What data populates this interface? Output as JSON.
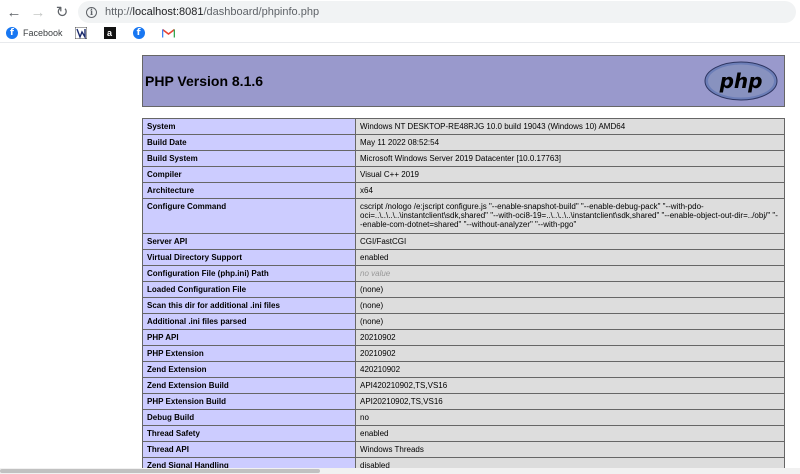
{
  "browser": {
    "url_prefix": "http://",
    "url_host": "localhost:8081",
    "url_path": "/dashboard/phpinfo.php",
    "bookmarks": [
      {
        "icon": "facebook-icon",
        "label": "Facebook"
      },
      {
        "icon": "wsj-icon",
        "label": ""
      },
      {
        "icon": "amazon-icon",
        "label": ""
      },
      {
        "icon": "facebook-icon",
        "label": ""
      },
      {
        "icon": "gmail-icon",
        "label": ""
      }
    ]
  },
  "phpinfo": {
    "title": "PHP Version 8.1.6",
    "logo_text": "php",
    "rows": [
      {
        "key": "System",
        "value": "Windows NT DESKTOP-RE48RJG 10.0 build 19043 (Windows 10) AMD64"
      },
      {
        "key": "Build Date",
        "value": "May 11 2022 08:52:54"
      },
      {
        "key": "Build System",
        "value": "Microsoft Windows Server 2019 Datacenter [10.0.17763]"
      },
      {
        "key": "Compiler",
        "value": "Visual C++ 2019"
      },
      {
        "key": "Architecture",
        "value": "x64"
      },
      {
        "key": "Configure Command",
        "value": "cscript /nologo /e:jscript configure.js \"--enable-snapshot-build\" \"--enable-debug-pack\" \"--with-pdo-oci=..\\..\\..\\..\\instantclient\\sdk,shared\" \"--with-oci8-19=..\\..\\..\\..\\instantclient\\sdk,shared\" \"--enable-object-out-dir=../obj/\" \"--enable-com-dotnet=shared\" \"--without-analyzer\" \"--with-pgo\""
      },
      {
        "key": "Server API",
        "value": "CGI/FastCGI"
      },
      {
        "key": "Virtual Directory Support",
        "value": "enabled"
      },
      {
        "key": "Configuration File (php.ini) Path",
        "value": "no value"
      },
      {
        "key": "Loaded Configuration File",
        "value": "(none)"
      },
      {
        "key": "Scan this dir for additional .ini files",
        "value": "(none)"
      },
      {
        "key": "Additional .ini files parsed",
        "value": "(none)"
      },
      {
        "key": "PHP API",
        "value": "20210902"
      },
      {
        "key": "PHP Extension",
        "value": "20210902"
      },
      {
        "key": "Zend Extension",
        "value": "420210902"
      },
      {
        "key": "Zend Extension Build",
        "value": "API420210902,TS,VS16"
      },
      {
        "key": "PHP Extension Build",
        "value": "API20210902,TS,VS16"
      },
      {
        "key": "Debug Build",
        "value": "no"
      },
      {
        "key": "Thread Safety",
        "value": "enabled"
      },
      {
        "key": "Thread API",
        "value": "Windows Threads"
      },
      {
        "key": "Zend Signal Handling",
        "value": "disabled"
      }
    ]
  }
}
